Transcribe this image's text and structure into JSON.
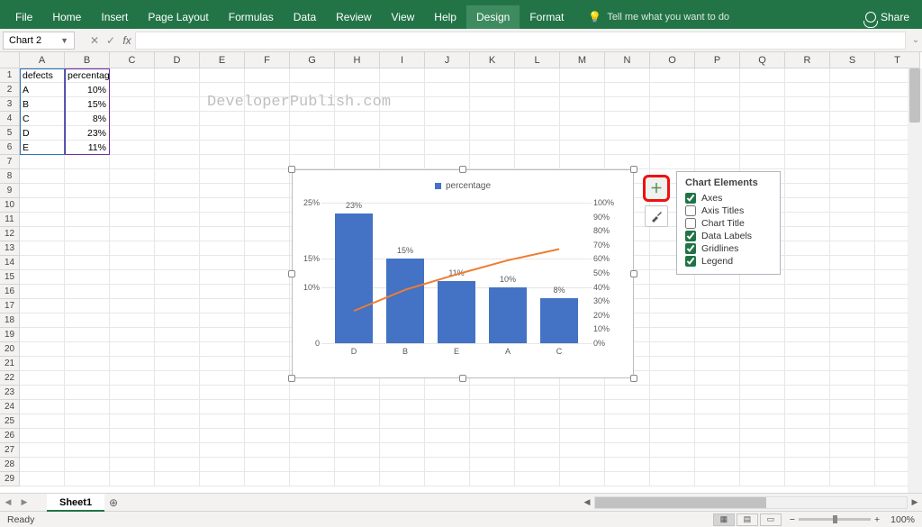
{
  "ribbon": {
    "tabs": [
      "File",
      "Home",
      "Insert",
      "Page Layout",
      "Formulas",
      "Data",
      "Review",
      "View",
      "Help",
      "Design",
      "Format"
    ],
    "active_tab": "Design",
    "tellme_placeholder": "Tell me what you want to do",
    "share_label": "Share"
  },
  "namebox": {
    "value": "Chart 2"
  },
  "watermark": "DeveloperPublish.com",
  "columns": [
    "A",
    "B",
    "C",
    "D",
    "E",
    "F",
    "G",
    "H",
    "I",
    "J",
    "K",
    "L",
    "M",
    "N",
    "O",
    "P",
    "Q",
    "R",
    "S",
    "T"
  ],
  "rows": 29,
  "data_cells": {
    "headers": [
      "defects",
      "percentage"
    ],
    "rows": [
      [
        "A",
        "10%"
      ],
      [
        "B",
        "15%"
      ],
      [
        "C",
        "8%"
      ],
      [
        "D",
        "23%"
      ],
      [
        "E",
        "11%"
      ]
    ]
  },
  "chart_data": {
    "type": "pareto",
    "legend": "percentage",
    "categories": [
      "D",
      "B",
      "E",
      "A",
      "C"
    ],
    "values": [
      23,
      15,
      11,
      10,
      8
    ],
    "data_labels": [
      "23%",
      "15%",
      "11%",
      "10%",
      "8%"
    ],
    "ylabel_ticks": [
      "25%",
      "15%",
      "10%",
      "0"
    ],
    "y2label_ticks": [
      "100%",
      "90%",
      "80%",
      "70%",
      "60%",
      "50%",
      "40%",
      "30%",
      "20%",
      "10%",
      "0%"
    ],
    "ylim": [
      0,
      25
    ],
    "y2lim": [
      0,
      100
    ],
    "cumulative": [
      23,
      38,
      49,
      59,
      67
    ]
  },
  "chart_elements_panel": {
    "title": "Chart Elements",
    "options": [
      {
        "label": "Axes",
        "checked": true
      },
      {
        "label": "Axis Titles",
        "checked": false
      },
      {
        "label": "Chart Title",
        "checked": false
      },
      {
        "label": "Data Labels",
        "checked": true
      },
      {
        "label": "Gridlines",
        "checked": true
      },
      {
        "label": "Legend",
        "checked": true
      }
    ]
  },
  "sheet_tabs": {
    "active": "Sheet1"
  },
  "status": {
    "text": "Ready",
    "zoom": "100%"
  }
}
